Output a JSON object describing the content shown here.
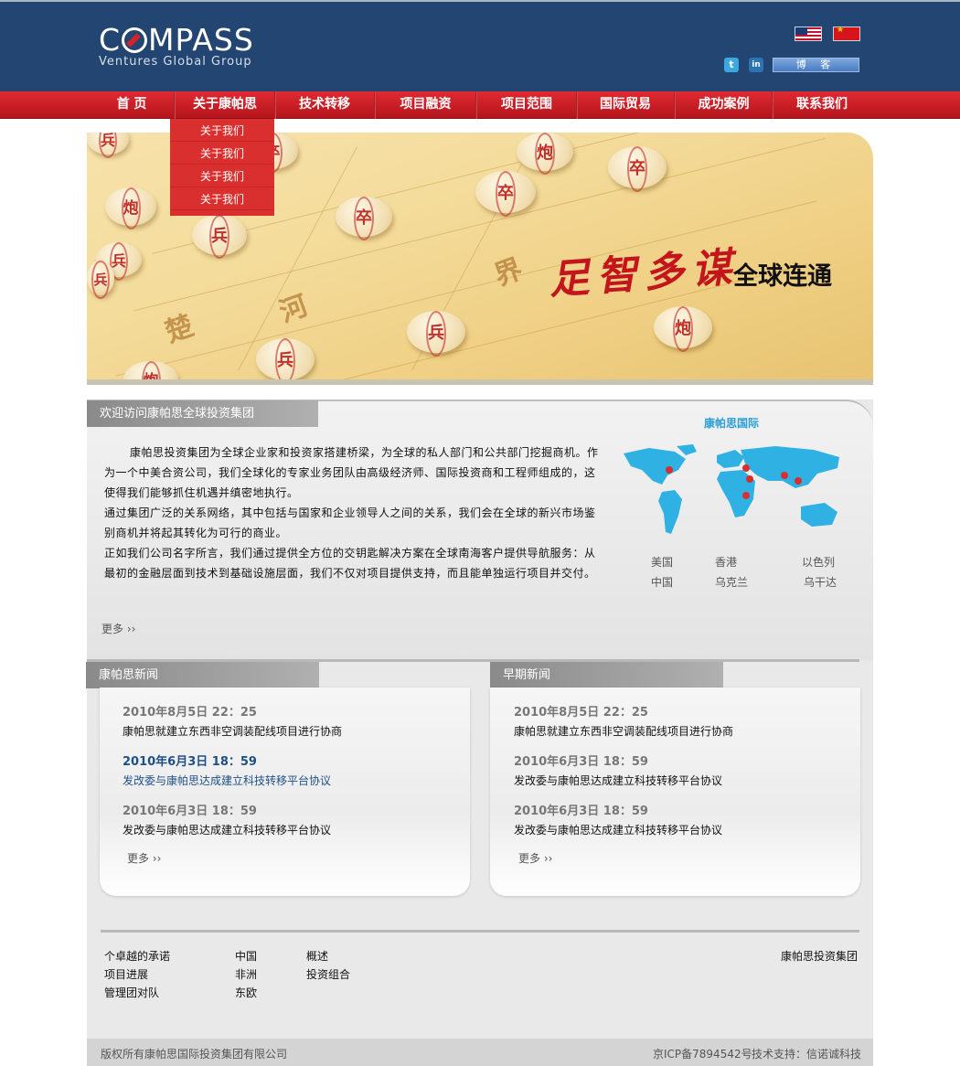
{
  "logo": {
    "main_prefix": "C",
    "main_suffix": "MPASS",
    "sub": "Ventures Global Group"
  },
  "header": {
    "blog_label": "博 客"
  },
  "nav": [
    "首  页",
    "关于康帕思",
    "技术转移",
    "项目融资",
    "项目范围",
    "国际贸易",
    "成功案例",
    "联系我们"
  ],
  "dropdown": [
    "关于我们",
    "关于我们",
    "关于我们",
    "关于我们"
  ],
  "banner": {
    "slogan_red": "足智多谋",
    "slogan_black": "全球连通",
    "pieces": [
      "兵",
      "炮",
      "兵",
      "兵",
      "卒",
      "卒",
      "炮",
      "卒",
      "卒",
      "炮",
      "兵",
      "兵",
      "炮",
      "兵"
    ],
    "board_chars": [
      "楚",
      "河",
      "界"
    ]
  },
  "about": {
    "tab": "欢迎访问康帕思全球投资集团",
    "paragraphs": [
      "康帕思投资集团为全球企业家和投资家搭建桥梁，为全球的私人部门和公共部门挖掘商机。作为一个中美合资公司，我们全球化的专家业务团队由高级经济师、国际投资商和工程师组成的，这使得我们能够抓住机遇并缜密地执行。",
      "通过集团广泛的关系网络，其中包括与国家和企业领导人之间的关系，我们会在全球的新兴市场鉴别商机并将起其转化为可行的商业。",
      "正如我们公司名字所言，我们通过提供全方位的交钥匙解决方案在全球南海客户提供导航服务：从最初的金融层面到技术到基础设施层面，我们不仅对项目提供支持，而且能单独运行项目并交付。"
    ],
    "more": "更多 ››"
  },
  "map": {
    "title": "康帕思国际",
    "locations": [
      [
        "美国",
        "香港",
        "以色列"
      ],
      [
        "中国",
        "乌克兰",
        "乌干达"
      ]
    ]
  },
  "news_left": {
    "tab": "康帕思新闻",
    "items": [
      {
        "date": "2010年8月5日  22：25",
        "title": "康帕思就建立东西非空调装配线项目进行协商",
        "highlight": false
      },
      {
        "date": "2010年6月3日  18：59",
        "title": "发改委与康帕思达成建立科技转移平台协议",
        "highlight": true
      },
      {
        "date": "2010年6月3日  18：59",
        "title": "发改委与康帕思达成建立科技转移平台协议",
        "highlight": false
      }
    ],
    "more": "更多 ››"
  },
  "news_right": {
    "tab": "早期新闻",
    "items": [
      {
        "date": "2010年8月5日  22：25",
        "title": "康帕思就建立东西非空调装配线项目进行协商",
        "highlight": false
      },
      {
        "date": "2010年6月3日  18：59",
        "title": "发改委与康帕思达成建立科技转移平台协议",
        "highlight": false
      },
      {
        "date": "2010年6月3日  18：59",
        "title": "发改委与康帕思达成建立科技转移平台协议",
        "highlight": false
      }
    ],
    "more": "更多 ››"
  },
  "footer": {
    "col1": [
      "个卓越的承诺",
      "项目进展",
      "管理团对队"
    ],
    "col2": [
      "中国",
      "非洲",
      "东欧"
    ],
    "col3": [
      "概述",
      "投资组合"
    ],
    "brand": "康帕思投资集团",
    "copyright": "版权所有康帕思国际投资集团有限公司",
    "icp": "京ICP备7894542号",
    "support": "技术支持：信诺诚科技"
  },
  "colors": {
    "header_bg": "#234572",
    "nav_red": "#d2232a",
    "accent_blue": "#2a9fd6",
    "highlight_blue": "#1f4f86"
  }
}
